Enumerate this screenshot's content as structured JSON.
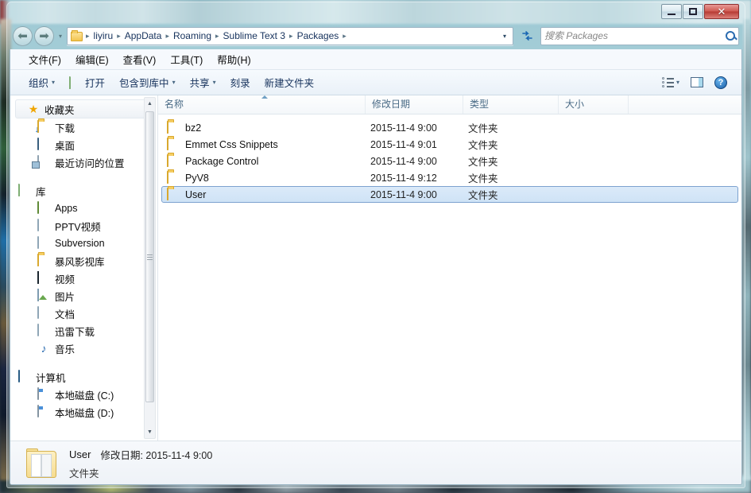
{
  "window": {
    "controls": {
      "minimize": "–",
      "maximize": "□",
      "close": "✕"
    }
  },
  "address": {
    "back_icon": "back-arrow",
    "forward_icon": "forward-arrow",
    "history_caret": "▾",
    "breadcrumbs": [
      "liyiru",
      "AppData",
      "Roaming",
      "Sublime Text 3",
      "Packages"
    ],
    "separator": "▸",
    "dropdown_caret": "▾",
    "refresh_icon": "↻"
  },
  "search": {
    "placeholder": "搜索 Packages",
    "value": "",
    "icon": "search-icon"
  },
  "menu": {
    "items": [
      "文件(F)",
      "编辑(E)",
      "查看(V)",
      "工具(T)",
      "帮助(H)"
    ]
  },
  "toolbar": {
    "organize": "组织",
    "open": "打开",
    "include_in_library": "包含到库中",
    "share": "共享",
    "burn": "刻录",
    "new_folder": "新建文件夹",
    "caret": "▾",
    "help_glyph": "?"
  },
  "sidebar": {
    "sections": [
      {
        "header": {
          "label": "收藏夹",
          "icon": "star-icon"
        },
        "items": [
          {
            "label": "下载",
            "icon": "downloads-folder-icon"
          },
          {
            "label": "桌面",
            "icon": "desktop-icon"
          },
          {
            "label": "最近访问的位置",
            "icon": "recent-places-icon"
          }
        ]
      },
      {
        "header": {
          "label": "库",
          "icon": "library-icon"
        },
        "items": [
          {
            "label": "Apps",
            "icon": "apps-icon"
          },
          {
            "label": "PPTV视频",
            "icon": "library-doc-icon"
          },
          {
            "label": "Subversion",
            "icon": "library-doc-icon"
          },
          {
            "label": "暴风影视库",
            "icon": "folder-icon"
          },
          {
            "label": "视频",
            "icon": "video-icon"
          },
          {
            "label": "图片",
            "icon": "pictures-icon"
          },
          {
            "label": "文档",
            "icon": "documents-icon"
          },
          {
            "label": "迅雷下载",
            "icon": "library-doc-icon"
          },
          {
            "label": "音乐",
            "icon": "music-icon"
          }
        ]
      },
      {
        "header": {
          "label": "计算机",
          "icon": "computer-icon"
        },
        "items": [
          {
            "label": "本地磁盘 (C:)",
            "icon": "drive-icon"
          },
          {
            "label": "本地磁盘 (D:)",
            "icon": "drive-icon"
          }
        ]
      }
    ],
    "scrollbar": {
      "up": "▲",
      "down": "▼"
    }
  },
  "filelist": {
    "columns": [
      "名称",
      "修改日期",
      "类型",
      "大小"
    ],
    "sort_column": "名称",
    "sort_direction": "ascending",
    "rows": [
      {
        "name": "bz2",
        "modified": "2015-11-4 9:00",
        "type": "文件夹",
        "size": "",
        "selected": false
      },
      {
        "name": "Emmet Css Snippets",
        "modified": "2015-11-4 9:01",
        "type": "文件夹",
        "size": "",
        "selected": false
      },
      {
        "name": "Package Control",
        "modified": "2015-11-4 9:00",
        "type": "文件夹",
        "size": "",
        "selected": false
      },
      {
        "name": "PyV8",
        "modified": "2015-11-4 9:12",
        "type": "文件夹",
        "size": "",
        "selected": false
      },
      {
        "name": "User",
        "modified": "2015-11-4 9:00",
        "type": "文件夹",
        "size": "",
        "selected": true
      }
    ]
  },
  "statusbar": {
    "name": "User",
    "modified_label": "修改日期:",
    "modified_value": "2015-11-4 9:00",
    "type": "文件夹",
    "icon": "folder-large-icon"
  }
}
